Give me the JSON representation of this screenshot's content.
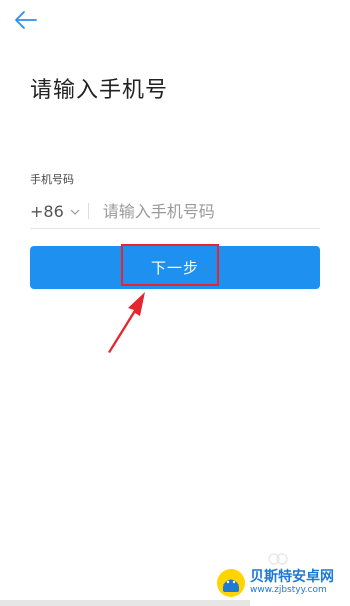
{
  "header": {
    "back_icon": "arrow-left-icon"
  },
  "page": {
    "title": "请输入手机号"
  },
  "form": {
    "field_label": "手机号码",
    "country_code": "+86",
    "country_chevron_icon": "chevron-down-icon",
    "phone_value": "",
    "phone_placeholder": "请输入手机号码"
  },
  "actions": {
    "next_label": "下一步"
  },
  "annotation": {
    "highlight_color": "#e5252f",
    "arrow_color": "#e5252f"
  },
  "watermark": {
    "name": "贝斯特安卓网",
    "url": "www.zjbstyy.com"
  },
  "colors": {
    "accent": "#1e90f0",
    "back_icon": "#2b8ff0"
  }
}
